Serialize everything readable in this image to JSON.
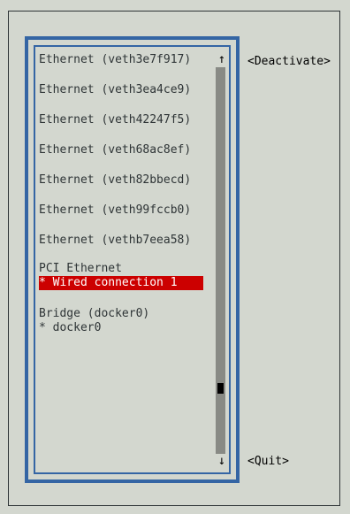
{
  "connections": [
    {
      "label": "Ethernet (veth3e7f917)",
      "type": "group"
    },
    {
      "label": "Ethernet (veth3ea4ce9)",
      "type": "group"
    },
    {
      "label": "Ethernet (veth42247f5)",
      "type": "group"
    },
    {
      "label": "Ethernet (veth68ac8ef)",
      "type": "group"
    },
    {
      "label": "Ethernet (veth82bbecd)",
      "type": "group"
    },
    {
      "label": "Ethernet (veth99fccb0)",
      "type": "group"
    },
    {
      "label": "Ethernet (vethb7eea58)",
      "type": "group"
    },
    {
      "label": "PCI Ethernet",
      "type": "group"
    },
    {
      "label": "* Wired connection 1",
      "type": "item",
      "selected": true
    },
    {
      "label": "Bridge (docker0)",
      "type": "group"
    },
    {
      "label": "* docker0",
      "type": "item"
    }
  ],
  "scroll": {
    "up_arrow": "↑",
    "down_arrow": "↓",
    "position": 0.84
  },
  "buttons": {
    "deactivate": "<Deactivate>",
    "quit": "<Quit>"
  },
  "colors": {
    "background": "#d3d7cf",
    "frame_blue": "#3465a4",
    "selection_red": "#cc0000",
    "scrollbar": "#888a85"
  }
}
